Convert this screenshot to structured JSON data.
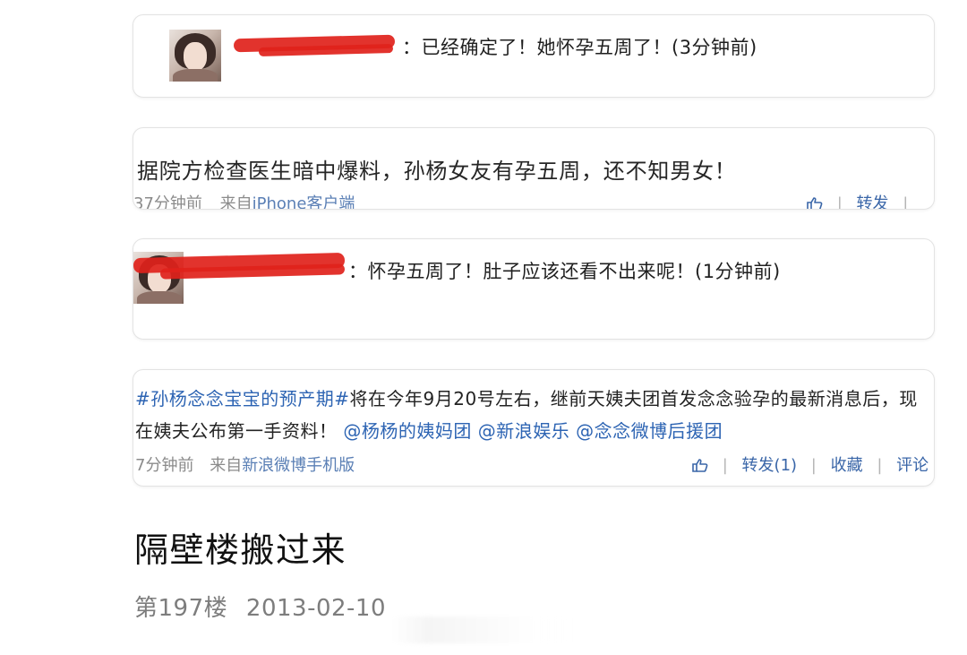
{
  "card1": {
    "comment_text": "：已经确定了！她怀孕五周了！(3分钟前)"
  },
  "card2": {
    "post_text": "据院方检查医生暗中爆料，孙杨女友有孕五周，还不知男女！",
    "time": "37分钟前",
    "source_prefix": "来自",
    "source": "iPhone客户端",
    "repost_label": "转发",
    "sep": "|"
  },
  "card3": {
    "comment_text": "：怀孕五周了！肚子应该还看不出来呢！(1分钟前)"
  },
  "card4": {
    "tag": "#孙杨念念宝宝的预产期#",
    "text_a": "将在今年9月20号左右，继前天姨夫团首发念念验孕的最新消息后，现在姨夫公布第一手资料！",
    "mention1": "@杨杨的姨妈团",
    "mention2": "@新浪娱乐",
    "mention3": "@念念微博后援团",
    "time": "7分钟前",
    "source_prefix": "来自",
    "source": "新浪微博手机版",
    "repost_label": "转发(1)",
    "favorite_label": "收藏",
    "comment_label": "评论",
    "sep": "|"
  },
  "post": {
    "heading": "隔壁楼搬过来",
    "floor": "第197楼",
    "date": "2013-02-10"
  },
  "icons": {
    "like": "thumbs-up-icon",
    "avatar": "user-avatar"
  },
  "colors": {
    "link_blue": "#2d64b3",
    "redaction_red": "#e0221b",
    "meta_gray": "#8b8b8b"
  }
}
